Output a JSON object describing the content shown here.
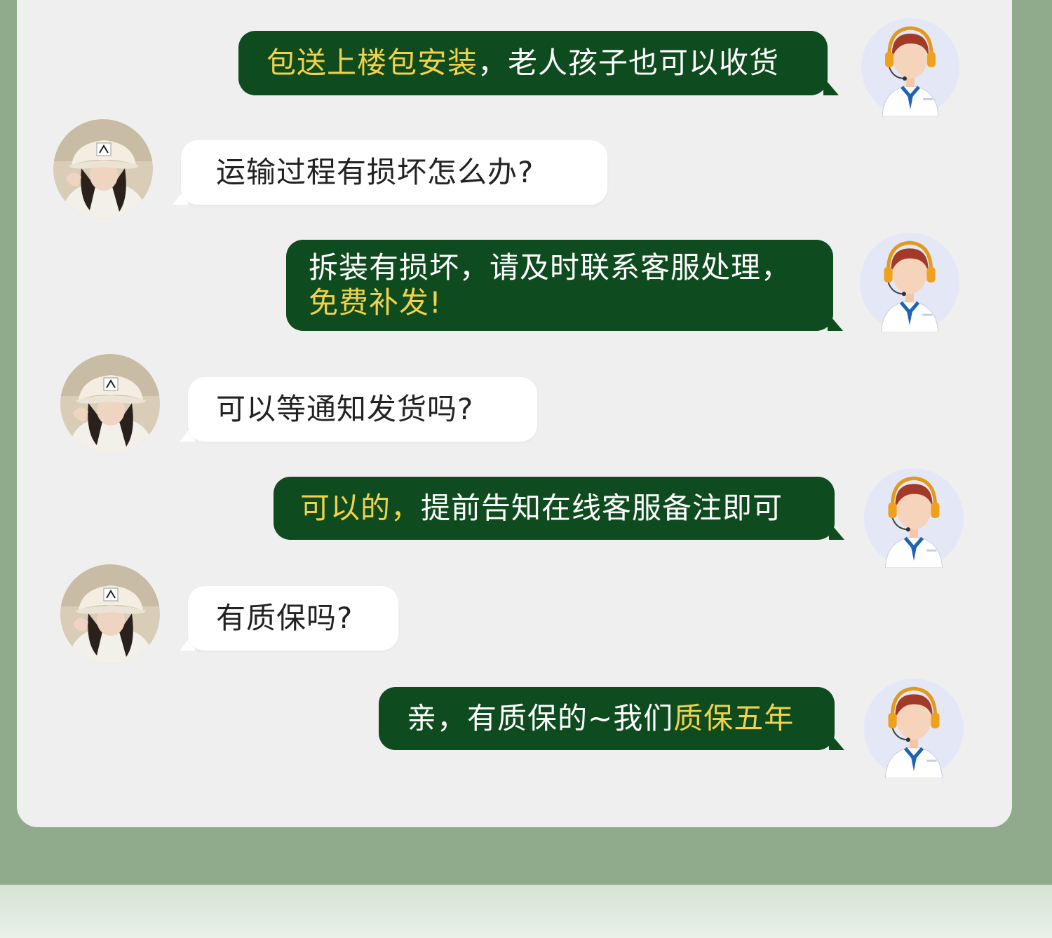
{
  "colors": {
    "page_background": "#8fab8b",
    "panel_background": "#efefef",
    "agent_bubble": "#0e4b1e",
    "agent_text": "#ffffff",
    "agent_highlight": "#f1d24a",
    "user_bubble": "#ffffff",
    "user_text": "#222222"
  },
  "conversation": {
    "messages": [
      {
        "sender": "agent",
        "avatar_icon": "customer-service-agent-icon",
        "highlight": "包送上楼包安装",
        "text": "，老人孩子也可以收货"
      },
      {
        "sender": "user",
        "avatar_icon": "user-avatar-photo",
        "text": "运输过程有损坏怎么办?"
      },
      {
        "sender": "agent",
        "avatar_icon": "customer-service-agent-icon",
        "text": "拆装有损坏，请及时联系客服处理，",
        "highlight": "免费补发!"
      },
      {
        "sender": "user",
        "avatar_icon": "user-avatar-photo",
        "text": "可以等通知发货吗?"
      },
      {
        "sender": "agent",
        "avatar_icon": "customer-service-agent-icon",
        "highlight": "可以的，",
        "text": "提前告知在线客服备注即可"
      },
      {
        "sender": "user",
        "avatar_icon": "user-avatar-photo",
        "text": "有质保吗?"
      },
      {
        "sender": "agent",
        "avatar_icon": "customer-service-agent-icon",
        "text": "亲，有质保的~我们",
        "highlight": "质保五年"
      }
    ]
  }
}
